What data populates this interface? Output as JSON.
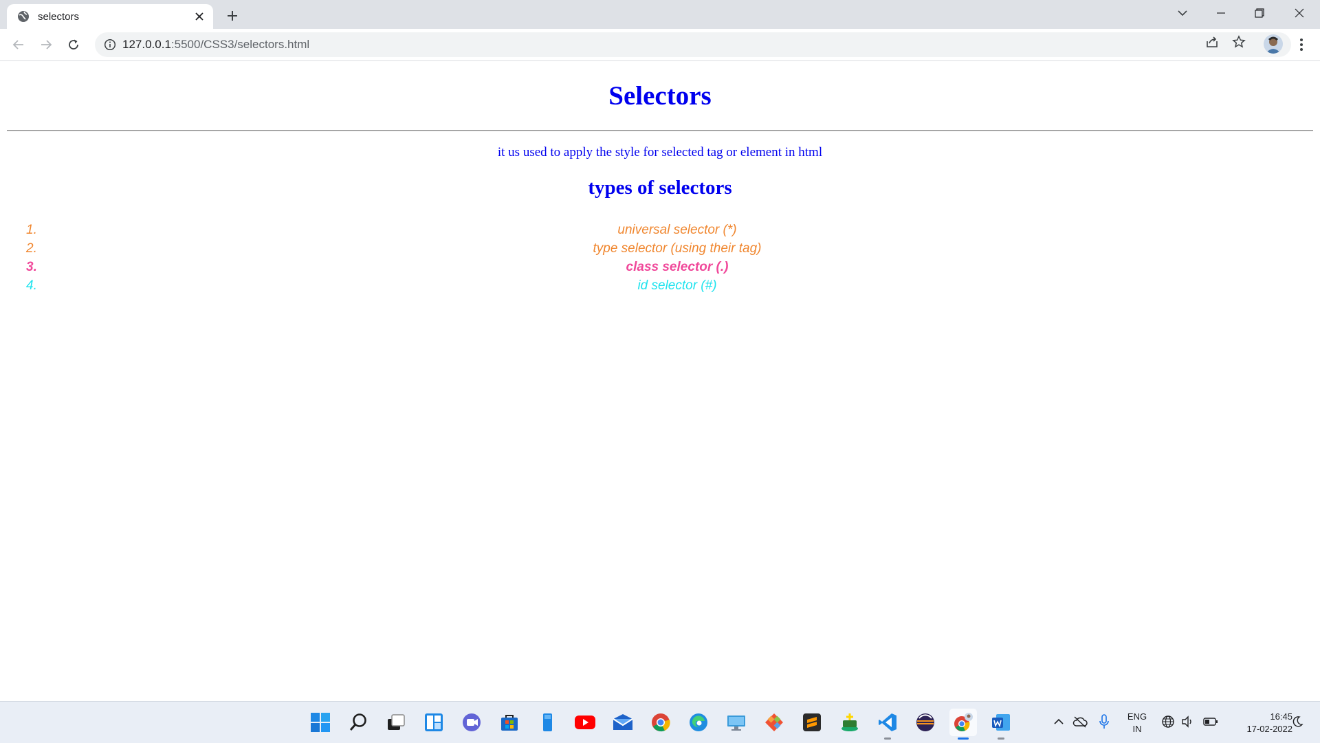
{
  "browser": {
    "tab_title": "selectors",
    "url_host": "127.0.0.1",
    "url_rest": ":5500/CSS3/selectors.html"
  },
  "page": {
    "heading": "Selectors",
    "description": "it us used to apply the style for selected tag or element in html",
    "subheading": "types of selectors",
    "list": [
      {
        "number": "1.",
        "text": "universal selector (*)",
        "color": "#f0862e"
      },
      {
        "number": "2.",
        "text": "type selector (using their tag)",
        "color": "#f0862e"
      },
      {
        "number": "3.",
        "text": "class selector (.)",
        "color": "#f0489a"
      },
      {
        "number": "4.",
        "text": "id selector (#)",
        "color": "#1ee3ee"
      }
    ]
  },
  "taskbar": {
    "apps": [
      "windows-start-icon",
      "search-icon",
      "task-view-icon",
      "widgets-icon",
      "teams-chat-icon",
      "microsoft-store-icon",
      "file-icon",
      "youtube-icon",
      "mail-icon",
      "chrome-icon",
      "edge-icon",
      "remote-desktop-icon",
      "git-icon",
      "sublime-text-icon",
      "app-icon",
      "vscode-icon",
      "eclipse-icon",
      "chrome-profile-icon",
      "word-icon"
    ],
    "language_line1": "ENG",
    "language_line2": "IN",
    "time": "16:45",
    "date": "17-02-2022"
  },
  "colors": {
    "heading": "#0000ee",
    "tabstrip": "#dee1e6",
    "taskbar": "#e9eef6"
  }
}
